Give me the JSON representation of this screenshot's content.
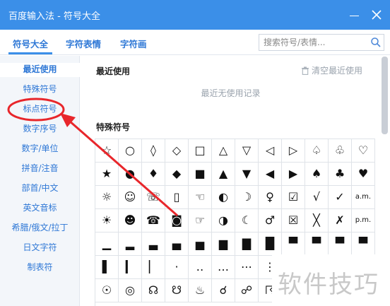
{
  "window": {
    "title": "百度输入法 - 符号大全",
    "minimize_icon": "minimize-icon",
    "close_icon": "close-icon",
    "accent_color": "#3b8fe8"
  },
  "tabs": [
    {
      "label": "符号大全",
      "active": true
    },
    {
      "label": "字符表情",
      "active": false
    },
    {
      "label": "字符画",
      "active": false
    }
  ],
  "search": {
    "placeholder": "搜索符号/表情...",
    "icon": "search-icon"
  },
  "sidebar": {
    "items": [
      {
        "label": "最近使用",
        "active": true
      },
      {
        "label": "特殊符号",
        "active": false
      },
      {
        "label": "标点符号",
        "active": false
      },
      {
        "label": "数字序号",
        "active": false
      },
      {
        "label": "数字/单位",
        "active": false
      },
      {
        "label": "拼音/注音",
        "active": false
      },
      {
        "label": "部首/中文",
        "active": false
      },
      {
        "label": "英文音标",
        "active": false
      },
      {
        "label": "希腊/俄文/拉丁",
        "active": false
      },
      {
        "label": "日文字符",
        "active": false
      },
      {
        "label": "制表符",
        "active": false
      }
    ]
  },
  "recent": {
    "title": "最近使用",
    "clear_label": "清空最近使用",
    "empty_message": "最近无使用记录"
  },
  "special": {
    "title": "特殊符号",
    "rows": [
      [
        "☆",
        "○",
        "◊",
        "◇",
        "□",
        "△",
        "▽",
        "◁",
        "▷",
        "♤",
        "♧",
        "♡"
      ],
      [
        "★",
        "●",
        "♦",
        "◆",
        "■",
        "▲",
        "▼",
        "◀",
        "▶",
        "♠",
        "♣",
        "♥"
      ],
      [
        "☼",
        "☺",
        "☏",
        "▯",
        "☜",
        "◐",
        "☽",
        "♀",
        "☑",
        "√",
        "✓",
        "a.m."
      ],
      [
        "☀",
        "☻",
        "☎",
        "◙",
        "☞",
        "◑",
        "☾",
        "♂",
        "☒",
        "╳",
        "✗",
        "p.m."
      ],
      [
        "▁",
        "▂",
        "▃",
        "▄",
        "▅",
        "▆",
        "▇",
        "█",
        "▀",
        "▀",
        "▀",
        "▀"
      ],
      [
        "▌",
        "▎",
        "▏",
        "·",
        "‥",
        "…",
        "⋯",
        "⋮",
        "",
        "",
        "",
        ""
      ],
      [
        "☉",
        "◎",
        "☊",
        "☋",
        "♨",
        "☌",
        "☍",
        "☈",
        "",
        "",
        "",
        ""
      ]
    ]
  },
  "annotation": {
    "highlight_color": "#e8262b",
    "target": "标点符号"
  },
  "watermark": {
    "text": "软件技巧"
  }
}
